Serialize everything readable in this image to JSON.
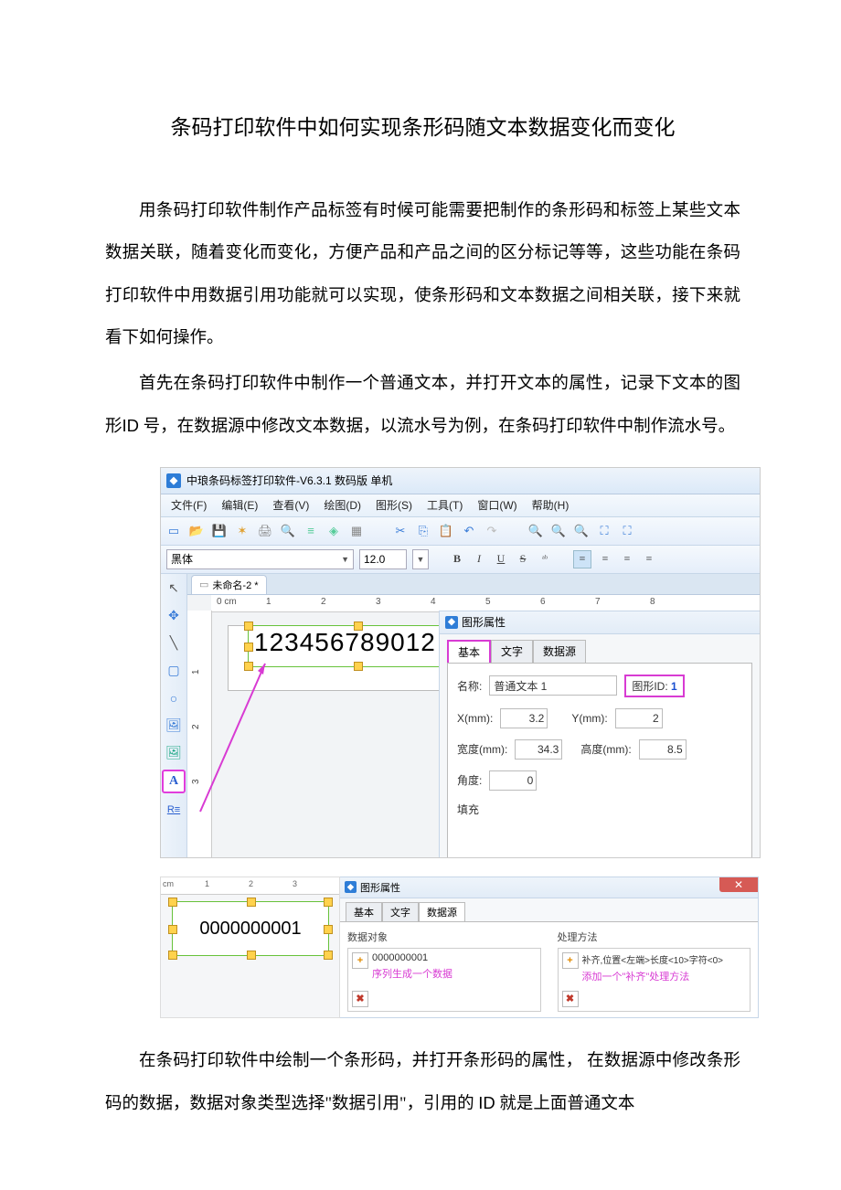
{
  "doc": {
    "title": "条码打印软件中如何实现条形码随文本数据变化而变化",
    "p1": "用条码打印软件制作产品标签有时候可能需要把制作的条形码和标签上某些文本数据关联，随着变化而变化，方便产品和产品之间的区分标记等等，这些功能在条码打印软件中用数据引用功能就可以实现，使条形码和文本数据之间相关联，接下来就看下如何操作。",
    "p2a": "首先在条码打印软件中制作一个普通文本，并打开文本的属性，记录下文本的图形",
    "p2b": "ID",
    "p2c": " 号，在数据源中修改文本数据，以流水号为例，在条码打印软件中制作流水号。",
    "p3a": "在条码打印软件中绘制一个条形码，并打开条形码的属性，  在数据源中修改条形码的数据，数据对象类型选择\"数据引用\"，引用的 ",
    "p3b": "ID",
    "p3c": " 就是上面普通文本"
  },
  "shot1": {
    "app_title": "中琅条码标签打印软件-V6.3.1 数码版 单机",
    "menus": [
      "文件(F)",
      "编辑(E)",
      "查看(V)",
      "绘图(D)",
      "图形(S)",
      "工具(T)",
      "窗口(W)",
      "帮助(H)"
    ],
    "font_name": "黑体",
    "font_size": "12.0",
    "doc_tab": "未命名-2 *",
    "ruler_unit": "0 cm",
    "ruler_marks": [
      "1",
      "2",
      "3",
      "4",
      "5",
      "6",
      "7",
      "8"
    ],
    "sel_text": "123456789012",
    "prop_title": "图形属性",
    "prop_tabs": [
      "基本",
      "文字",
      "数据源"
    ],
    "name_label": "名称:",
    "name_value": "普通文本 1",
    "id_label": "图形ID:",
    "id_value": "1",
    "x_label": "X(mm):",
    "x_value": "3.2",
    "y_label": "Y(mm):",
    "y_value": "2",
    "w_label": "宽度(mm):",
    "w_value": "34.3",
    "h_label": "高度(mm):",
    "h_value": "8.5",
    "angle_label": "角度:",
    "angle_value": "0",
    "fill_label": "填充"
  },
  "shot2": {
    "ruler_marks": [
      "cm",
      "1",
      "2",
      "3"
    ],
    "sel_text": "0000000001",
    "prop_title": "图形属性",
    "tabs": [
      "基本",
      "文字",
      "数据源"
    ],
    "grp1_title": "数据对象",
    "data_value": "0000000001",
    "data_desc": "序列生成一个数据",
    "grp2_title": "处理方法",
    "proc_text": "补齐,位置<左端>长度<10>字符<0>",
    "proc_desc": "添加一个\"补齐\"处理方法"
  }
}
